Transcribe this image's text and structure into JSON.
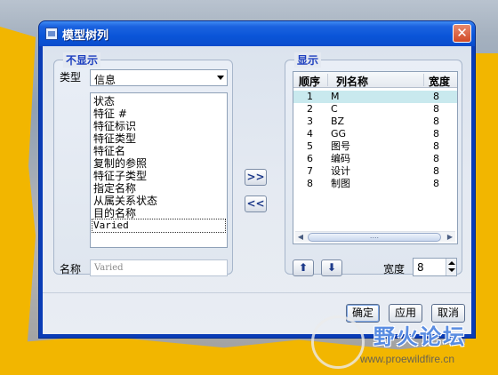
{
  "window": {
    "title": "模型树列",
    "close_icon": "close-icon"
  },
  "left_group": {
    "legend": "不显示",
    "type_label": "类型",
    "type_value": "信息",
    "items": [
      "状态",
      "特征 #",
      "特征标识",
      "特征类型",
      "特征名",
      "复制的参照",
      "特征子类型",
      "指定名称",
      "从属关系状态",
      "目的名称",
      "Varied"
    ],
    "selected_item": "Varied",
    "name_label": "名称",
    "name_value": "Varied"
  },
  "move_buttons": {
    "add_label": ">>",
    "remove_label": "<<"
  },
  "right_group": {
    "legend": "显示",
    "columns": [
      "顺序",
      "列名称",
      "宽度"
    ],
    "rows": [
      {
        "order": "1",
        "name": "M",
        "width": "8"
      },
      {
        "order": "2",
        "name": "C",
        "width": "8"
      },
      {
        "order": "3",
        "name": "BZ",
        "width": "8"
      },
      {
        "order": "4",
        "name": "GG",
        "width": "8"
      },
      {
        "order": "5",
        "name": "图号",
        "width": "8"
      },
      {
        "order": "6",
        "name": "编码",
        "width": "8"
      },
      {
        "order": "7",
        "name": "设计",
        "width": "8"
      },
      {
        "order": "8",
        "name": "制图",
        "width": "8"
      }
    ],
    "selected_row": 0,
    "scroll_grip": "....",
    "width_label": "宽度",
    "width_value": "8"
  },
  "buttons": {
    "ok": "确定",
    "apply": "应用",
    "cancel": "取消"
  },
  "watermark": {
    "title": "野火论坛",
    "url": "www.proewildfire.cn"
  },
  "colors": {
    "title_bar": "#0a55d8",
    "legend_text": "#1d3fbf",
    "selected_row": "#c9e9ee",
    "background_stripe": "#f2b600"
  }
}
